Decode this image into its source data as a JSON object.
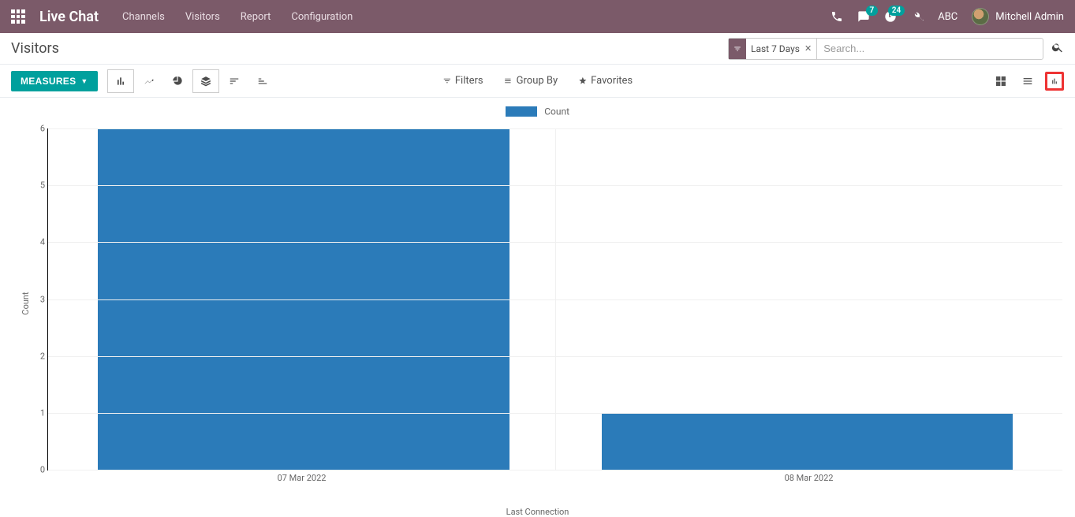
{
  "navbar": {
    "brand": "Live Chat",
    "menu": [
      "Channels",
      "Visitors",
      "Report",
      "Configuration"
    ],
    "messages_badge": "7",
    "activities_badge": "24",
    "company": "ABC",
    "user": "Mitchell Admin"
  },
  "page": {
    "title": "Visitors"
  },
  "search": {
    "facet_label": "Last 7 Days",
    "placeholder": "Search..."
  },
  "controls": {
    "measures_label": "MEASURES",
    "filters": "Filters",
    "group_by": "Group By",
    "favorites": "Favorites"
  },
  "chart_data": {
    "type": "bar",
    "title": "",
    "legend_label": "Count",
    "xlabel": "Last Connection",
    "ylabel": "Count",
    "ylim": [
      0,
      6
    ],
    "y_ticks": [
      0,
      1,
      2,
      3,
      4,
      5,
      6
    ],
    "categories": [
      "07 Mar 2022",
      "08 Mar 2022"
    ],
    "values": [
      6,
      1
    ]
  }
}
